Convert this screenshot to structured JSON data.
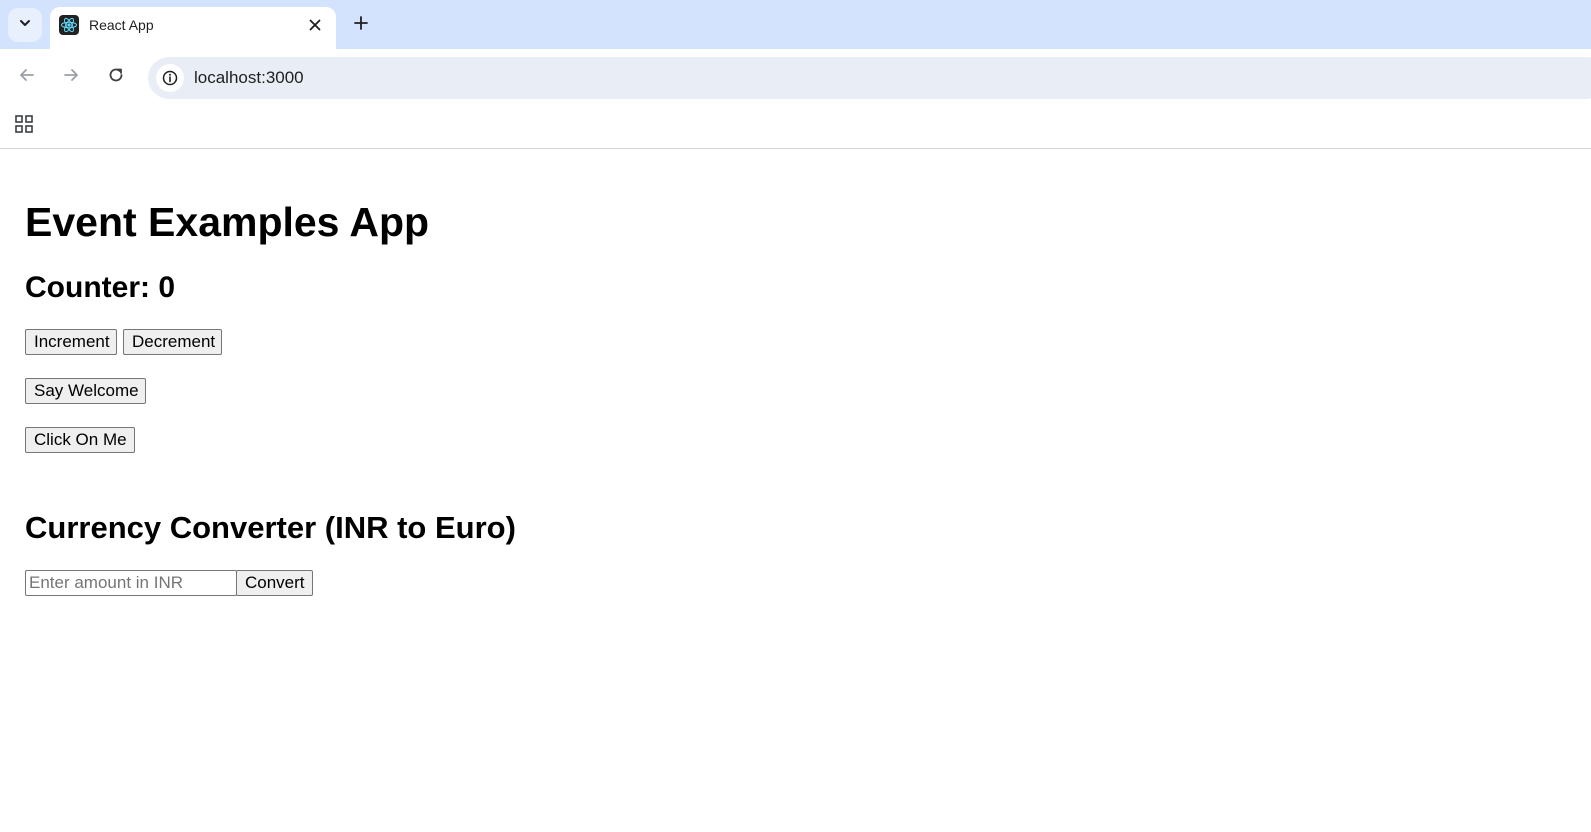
{
  "browser": {
    "tab": {
      "title": "React App",
      "favicon": "react-logo-icon"
    },
    "address_bar": {
      "url": "localhost:3000"
    },
    "icons": {
      "tab_search": "chevron-down-icon",
      "tab_close": "close-icon",
      "new_tab": "plus-icon",
      "back": "arrow-left-icon",
      "forward": "arrow-right-icon",
      "reload": "reload-icon",
      "site_info": "info-icon",
      "apps": "apps-grid-icon"
    },
    "colors": {
      "tabstrip": "#d3e3fd",
      "omnibox": "#e9eef6"
    }
  },
  "page": {
    "title": "Event Examples App",
    "counter": {
      "label": "Counter: 0"
    },
    "buttons": {
      "increment": "Increment",
      "decrement": "Decrement",
      "say_welcome": "Say Welcome",
      "click_on_me": "Click On Me"
    },
    "currency": {
      "title": "Currency Converter (INR to Euro)",
      "input_value": "",
      "input_placeholder": "Enter amount in INR",
      "convert_label": "Convert"
    }
  }
}
